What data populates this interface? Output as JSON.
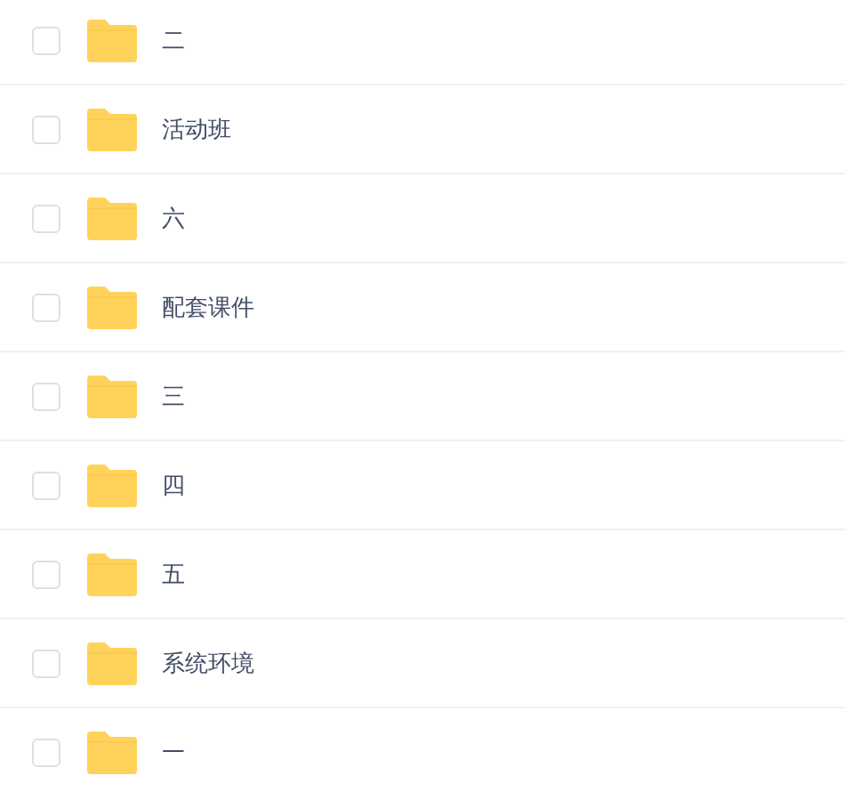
{
  "files": [
    {
      "name": "二",
      "checked": false
    },
    {
      "name": "活动班",
      "checked": false
    },
    {
      "name": "六",
      "checked": false
    },
    {
      "name": "配套课件",
      "checked": false
    },
    {
      "name": "三",
      "checked": false
    },
    {
      "name": "四",
      "checked": false
    },
    {
      "name": "五",
      "checked": false
    },
    {
      "name": "系统环境",
      "checked": false
    },
    {
      "name": "一",
      "checked": false
    }
  ]
}
